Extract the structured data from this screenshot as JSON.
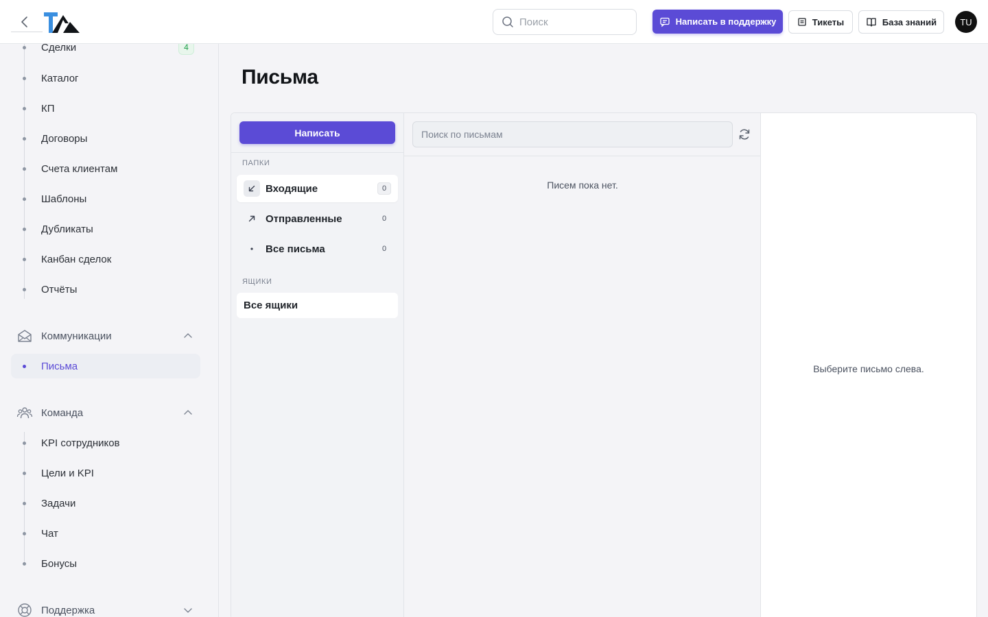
{
  "header": {
    "search_placeholder": "Поиск",
    "support_button": "Написать в поддержку",
    "tickets_button": "Тикеты",
    "knowledge_base_button": "База знаний",
    "avatar_initials": "TU",
    "accent_color": "#5b4bd6"
  },
  "sidebar": {
    "items": [
      {
        "label": "Сделки",
        "badge": "4"
      },
      {
        "label": "Каталог"
      },
      {
        "label": "КП"
      },
      {
        "label": "Договоры"
      },
      {
        "label": "Счета клиентам"
      },
      {
        "label": "Шаблоны"
      },
      {
        "label": "Дубликаты"
      },
      {
        "label": "Канбан сделок"
      },
      {
        "label": "Отчёты"
      }
    ],
    "communications": {
      "label": "Коммуникации",
      "icon": "envelope-open-icon",
      "expanded": true,
      "items": [
        {
          "label": "Письма",
          "active": true
        }
      ]
    },
    "team": {
      "label": "Команда",
      "icon": "users-icon",
      "expanded": true,
      "items": [
        {
          "label": "KPI сотрудников"
        },
        {
          "label": "Цели и KPI"
        },
        {
          "label": "Задачи"
        },
        {
          "label": "Чат"
        },
        {
          "label": "Бонусы"
        }
      ]
    },
    "support": {
      "label": "Поддержка",
      "icon": "lifebuoy-icon",
      "expanded": false
    }
  },
  "main": {
    "title": "Письма",
    "compose_button": "Написать",
    "folders_label": "ПАПКИ",
    "folders": [
      {
        "label": "Входящие",
        "count": "0",
        "icon": "arrow-down-left-icon",
        "active": true
      },
      {
        "label": "Отправленные",
        "count": "0",
        "icon": "arrow-up-right-icon"
      },
      {
        "label": "Все письма",
        "count": "0",
        "icon": "dot-icon"
      }
    ],
    "mailboxes_label": "ЯЩИКИ",
    "mailboxes": [
      {
        "label": "Все ящики",
        "active": true
      }
    ],
    "list_search_placeholder": "Поиск по письмам",
    "empty_list_text": "Писем пока нет.",
    "empty_preview_text": "Выберите письмо слева."
  }
}
